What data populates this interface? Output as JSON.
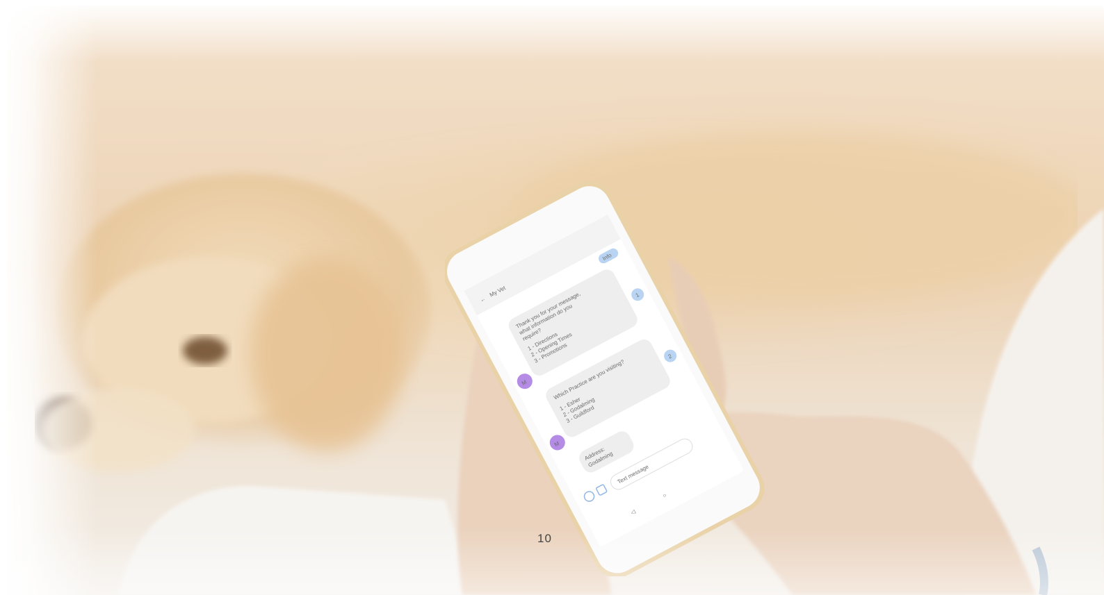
{
  "photo": {
    "subject": "person texting on smartphone with dog on sofa"
  },
  "phone": {
    "contact_name": "My Vet",
    "info_button": "Info",
    "avatar_letter": "M",
    "message1": {
      "lines": [
        "Thank you for your message,",
        "what information do you",
        "require?",
        "1 - Directions",
        "2 - Opening Times",
        "3 - Promotions"
      ],
      "badge": "1"
    },
    "message2": {
      "lines": [
        "Which Practice are you visiting?",
        "1 - Esher",
        "2 - Godalming",
        "3 - Guildford"
      ],
      "badge": "2"
    },
    "message3": {
      "lines": [
        "Address:",
        "Godalming"
      ]
    },
    "input_placeholder": "Text message"
  },
  "page_number": "10",
  "colors": {
    "avatar": "#b48ce6",
    "badge": "#b9d4f2",
    "bubble": "#eeeeee",
    "page_number": "#444444"
  }
}
